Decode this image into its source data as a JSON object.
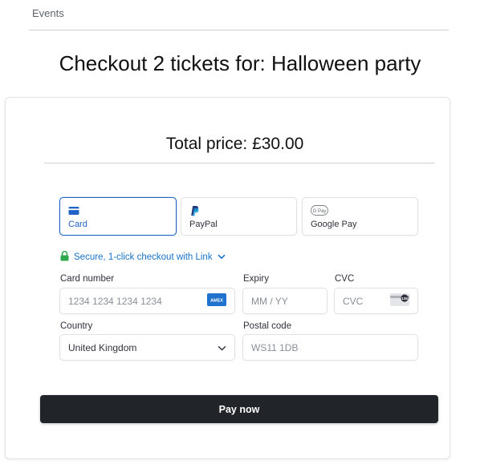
{
  "breadcrumb": "Events",
  "page_title": "Checkout 2 tickets for: Halloween party",
  "total_price": "Total price: £30.00",
  "payment_methods": [
    {
      "label": "Card",
      "icon": "credit-card-icon",
      "selected": true
    },
    {
      "label": "PayPal",
      "icon": "paypal-icon",
      "selected": false
    },
    {
      "label": "Google Pay",
      "icon": "google-pay-icon",
      "selected": false,
      "badge": "G Pay"
    }
  ],
  "link_checkout": {
    "text": "Secure, 1-click checkout with Link",
    "icon": "lock-icon"
  },
  "card_number": {
    "label": "Card number",
    "placeholder": "1234 1234 1234 1234",
    "value": "",
    "brand_badge": "AMEX"
  },
  "expiry": {
    "label": "Expiry",
    "placeholder": "MM / YY",
    "value": ""
  },
  "cvc": {
    "label": "CVC",
    "placeholder": "CVC",
    "value": "",
    "hint_badge": "135"
  },
  "country": {
    "label": "Country",
    "value": "United Kingdom"
  },
  "postal_code": {
    "label": "Postal code",
    "placeholder": "WS11 1DB",
    "value": ""
  },
  "pay_button": "Pay now",
  "colors": {
    "accent": "#1f63c6",
    "link": "#1a73c7",
    "lock": "#2fa84f",
    "button": "#212529"
  }
}
